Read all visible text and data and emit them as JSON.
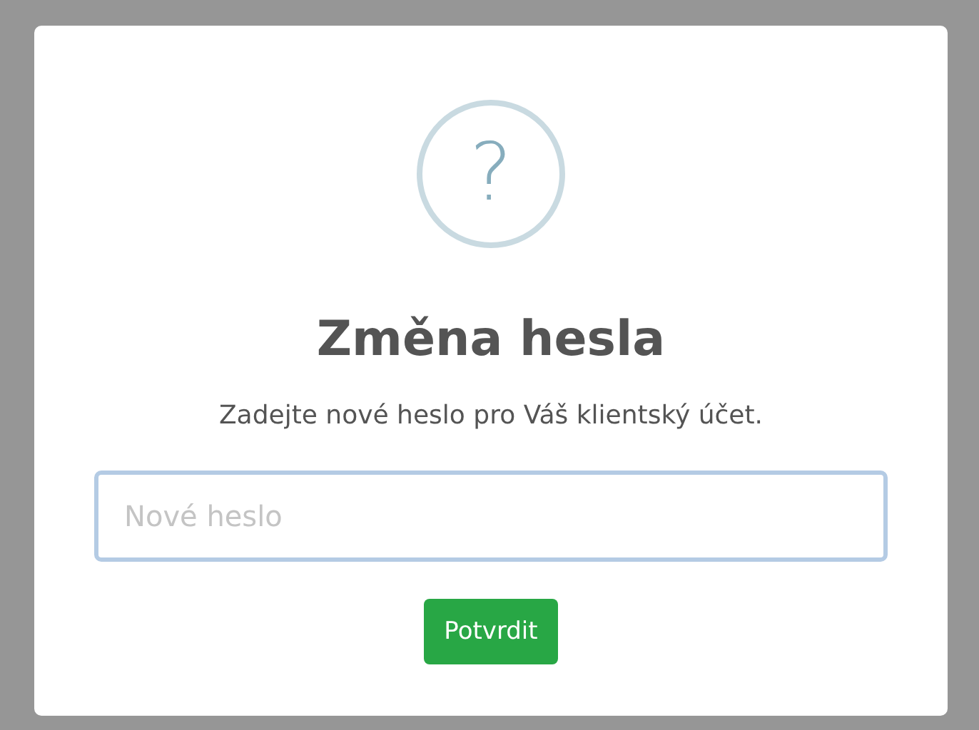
{
  "dialog": {
    "icon": "?",
    "title": "Změna hesla",
    "text": "Zadejte nové heslo pro Váš klientský účet.",
    "input": {
      "placeholder": "Nové heslo"
    },
    "buttons": [
      {
        "label": "Potvrdit"
      }
    ]
  }
}
